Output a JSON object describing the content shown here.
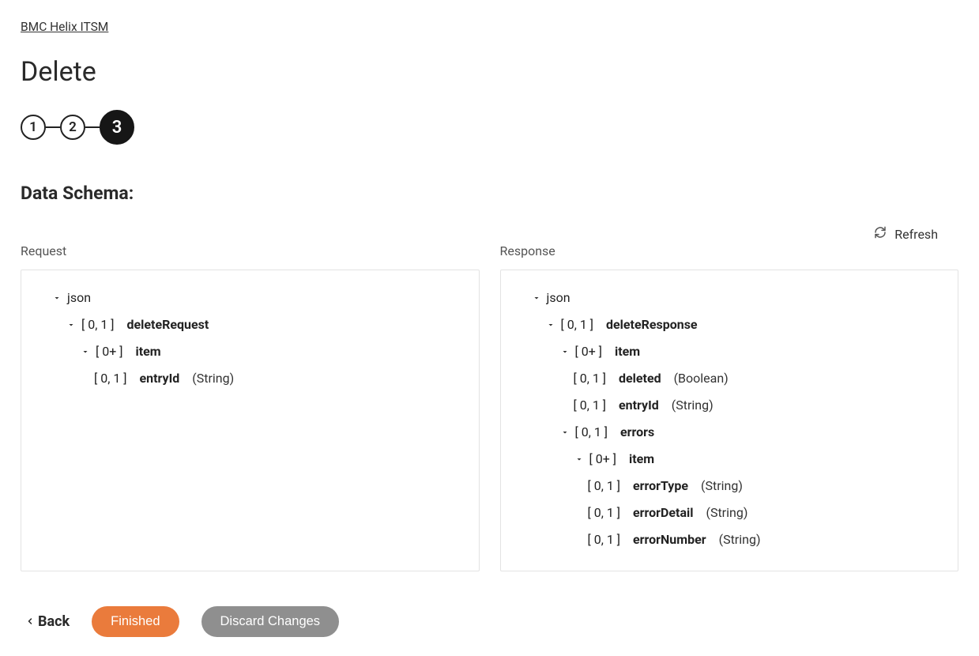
{
  "breadcrumb": "BMC Helix ITSM",
  "page_title": "Delete",
  "steps": [
    "1",
    "2",
    "3"
  ],
  "active_step_index": 2,
  "section_title": "Data Schema:",
  "refresh_label": "Refresh",
  "request_label": "Request",
  "response_label": "Response",
  "request_tree": {
    "root": "json",
    "n0_card": "[ 0, 1 ]",
    "n0_name": "deleteRequest",
    "n1_card": "[ 0+ ]",
    "n1_name": "item",
    "n2_card": "[ 0, 1 ]",
    "n2_name": "entryId",
    "n2_type": "(String)"
  },
  "response_tree": {
    "root": "json",
    "n0_card": "[ 0, 1 ]",
    "n0_name": "deleteResponse",
    "n1_card": "[ 0+ ]",
    "n1_name": "item",
    "n2_card": "[ 0, 1 ]",
    "n2_name": "deleted",
    "n2_type": "(Boolean)",
    "n3_card": "[ 0, 1 ]",
    "n3_name": "entryId",
    "n3_type": "(String)",
    "n4_card": "[ 0, 1 ]",
    "n4_name": "errors",
    "n5_card": "[ 0+ ]",
    "n5_name": "item",
    "n6_card": "[ 0, 1 ]",
    "n6_name": "errorType",
    "n6_type": "(String)",
    "n7_card": "[ 0, 1 ]",
    "n7_name": "errorDetail",
    "n7_type": "(String)",
    "n8_card": "[ 0, 1 ]",
    "n8_name": "errorNumber",
    "n8_type": "(String)"
  },
  "footer": {
    "back": "Back",
    "finished": "Finished",
    "discard": "Discard Changes"
  }
}
